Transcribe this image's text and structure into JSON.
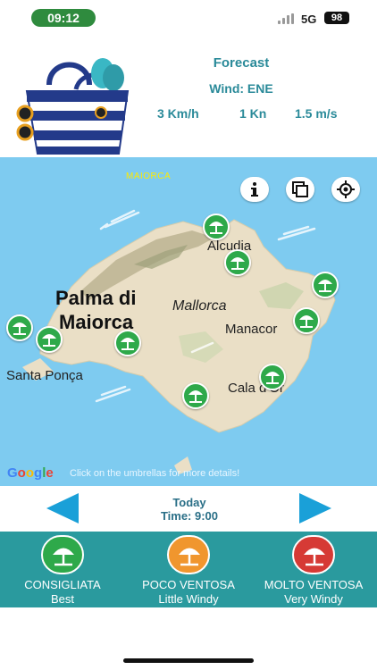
{
  "status": {
    "time": "09:12",
    "network": "5G",
    "battery": "98"
  },
  "forecast": {
    "title": "Forecast",
    "wind": "Wind: ENE",
    "speed_kmh": "3 Km/h",
    "speed_kn": "1 Kn",
    "speed_ms": "1.5 m/s"
  },
  "map": {
    "region_label": "MAIORCA",
    "labels": {
      "palma_line1": "Palma di",
      "palma_line2": "Maiorca",
      "mallorca": "Mallorca",
      "alcudia": "Alcudia",
      "manacor": "Manacor",
      "santa_ponsa": "Santa Ponça",
      "cala_dor": "Cala d'Or"
    },
    "google": [
      "G",
      "o",
      "o",
      "g",
      "l",
      "e"
    ],
    "hint": "Click on the umbrellas for more details!",
    "buttons": [
      "info-icon",
      "layers-icon",
      "locate-icon"
    ]
  },
  "navigation": {
    "day": "Today",
    "time": "Time: 9:00"
  },
  "legend": [
    {
      "it": "CONSIGLIATA",
      "en": "Best",
      "color": "#2ea94a"
    },
    {
      "it": "POCO VENTOSA",
      "en": "Little Windy",
      "color": "#f0962e"
    },
    {
      "it": "MOLTO VENTOSA",
      "en": "Very Windy",
      "color": "#d63a35"
    }
  ],
  "colors": {
    "accent": "#2a8a99",
    "legend_bg": "#2a9a9e",
    "nav_arrow": "#1aa0d8",
    "best": "#2ea94a"
  }
}
